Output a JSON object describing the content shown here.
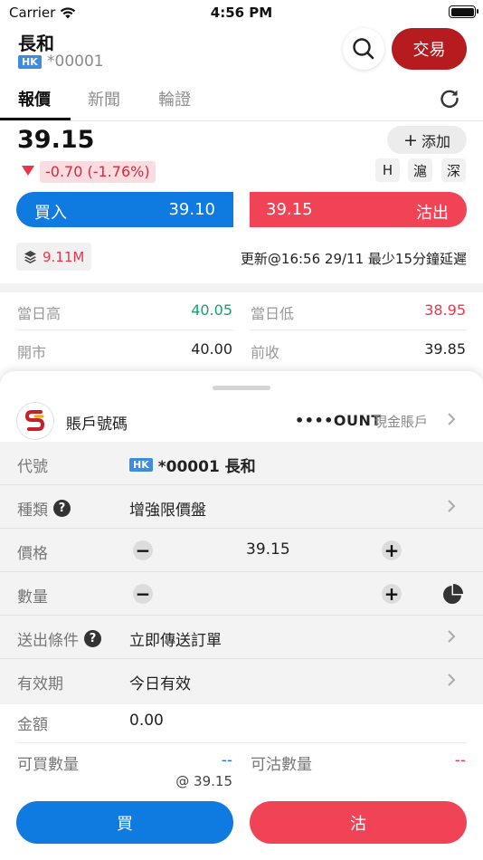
{
  "status_bar": {
    "carrier": "Carrier",
    "time": "4:56 PM"
  },
  "header": {
    "stock_name": "長和",
    "market_badge": "HK",
    "stock_code": "*00001",
    "trade_label": "交易"
  },
  "tabs": [
    {
      "label": "報價",
      "active": true
    },
    {
      "label": "新聞",
      "active": false
    },
    {
      "label": "輪證",
      "active": false
    }
  ],
  "quote": {
    "price": "39.15",
    "change": "-0.70 (-1.76%)",
    "add_label": "添加",
    "markets": [
      "H",
      "滬",
      "深"
    ],
    "buy_label": "買入",
    "bid": "39.10",
    "ask": "39.15",
    "sell_label": "沽出",
    "volume": "9.11M",
    "update_text": "更新@16:56 29/11 最少15分鐘延遲"
  },
  "stats": {
    "day_high_label": "當日高",
    "day_high": "40.05",
    "day_low_label": "當日低",
    "day_low": "38.95",
    "open_label": "開市",
    "open": "40.00",
    "prev_close_label": "前收",
    "prev_close": "39.85"
  },
  "order_sheet": {
    "account_label": "賬戶號碼",
    "account_number": "••••OUNT",
    "account_type": "現金賬戶",
    "code_label": "代號",
    "code_badge": "HK",
    "code_value": "*00001 長和",
    "type_label": "種類",
    "type_value": "增強限價盤",
    "price_label": "價格",
    "price_value": "39.15",
    "qty_label": "數量",
    "qty_value": "",
    "condition_label": "送出條件",
    "condition_value": "立即傳送訂單",
    "validity_label": "有效期",
    "validity_value": "今日有效",
    "amount_label": "金額",
    "amount_value": "0.00",
    "buyable_label": "可買數量",
    "buyable_value": "--",
    "buyable_at": "@ 39.15",
    "sellable_label": "可沽數量",
    "sellable_value": "--",
    "buy_button": "買",
    "sell_button": "沽"
  },
  "colors": {
    "up": "#1aa06b",
    "down": "#e8364c",
    "buy": "#0f7adf",
    "sell": "#f04356",
    "trade": "#b51b1f"
  }
}
